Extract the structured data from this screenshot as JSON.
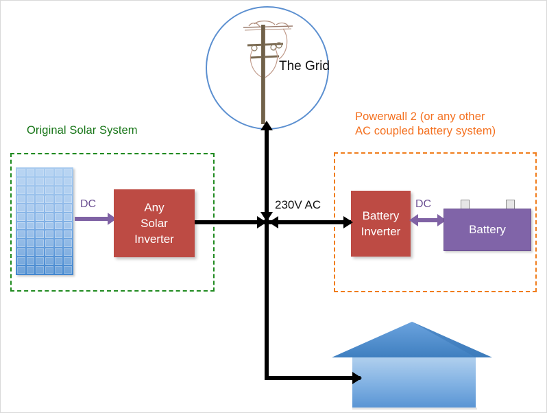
{
  "diagram": {
    "title_present": false,
    "colors": {
      "inverter_box": "#bd4b44",
      "battery_box": "#8064a8",
      "solar_panel": "#6da4e0",
      "house": "#5b9bd5",
      "grid_circle_stroke": "#5b8fd0",
      "solar_group_dash": "#1f8a1f",
      "powerwall_group_dash": "#f07d1c",
      "dc_arrow": "#7f62a4",
      "ac_wire": "#000000"
    },
    "groups": {
      "solar": {
        "label": "Original Solar System"
      },
      "powerwall": {
        "label": "Powerwall 2 (or any other\nAC coupled battery system)"
      }
    },
    "nodes": {
      "solar_panel": {
        "name": "solar-panel",
        "label": "",
        "columns": 6,
        "rows": 12
      },
      "solar_inverter": {
        "label": "Any\nSolar\nInverter"
      },
      "battery_inverter": {
        "label": "Battery\nInverter"
      },
      "battery": {
        "label": "Battery"
      },
      "grid": {
        "label": "The Grid"
      },
      "house": {
        "label": ""
      }
    },
    "edges": {
      "panel_to_solar_inverter": {
        "label": "DC",
        "direction": "one-way"
      },
      "solar_inverter_to_junction": {
        "label": "",
        "direction": "one-way"
      },
      "junction_to_grid": {
        "label": "",
        "direction": "two-way"
      },
      "junction_to_battery_inverter": {
        "label": "",
        "direction": "one-way"
      },
      "junction_to_house": {
        "label": "",
        "direction": "one-way"
      },
      "battery_inverter_to_battery": {
        "label": "DC",
        "direction": "two-way"
      },
      "bus": {
        "label": "230V AC"
      }
    }
  }
}
